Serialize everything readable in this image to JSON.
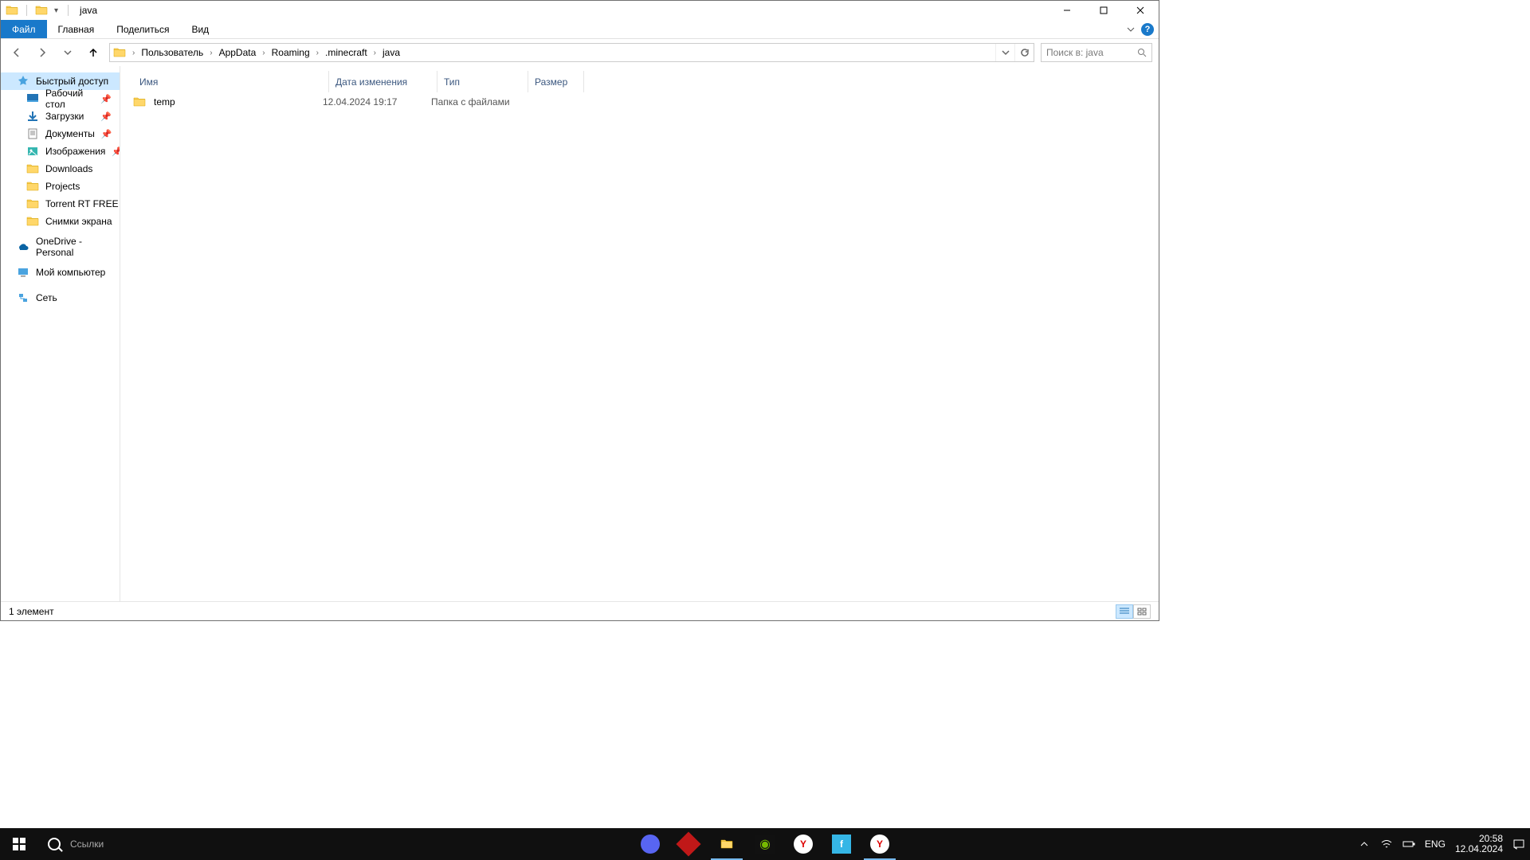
{
  "window": {
    "title": "java"
  },
  "ribbon": {
    "file": "Файл",
    "tabs": [
      "Главная",
      "Поделиться",
      "Вид"
    ],
    "help": "?"
  },
  "breadcrumbs": [
    "Пользователь",
    "AppData",
    "Roaming",
    ".minecraft",
    "java"
  ],
  "search": {
    "placeholder": "Поиск в: java"
  },
  "columns": {
    "name": "Имя",
    "modified": "Дата изменения",
    "type": "Тип",
    "size": "Размер"
  },
  "rows": [
    {
      "name": "temp",
      "modified": "12.04.2024 19:17",
      "type": "Папка с файлами",
      "size": ""
    }
  ],
  "nav": {
    "quick": "Быстрый доступ",
    "quick_items": [
      {
        "label": "Рабочий стол",
        "kind": "desktop",
        "pinned": true
      },
      {
        "label": "Загрузки",
        "kind": "downloads",
        "pinned": true
      },
      {
        "label": "Документы",
        "kind": "documents",
        "pinned": true
      },
      {
        "label": "Изображения",
        "kind": "pictures",
        "pinned": true
      },
      {
        "label": "Downloads",
        "kind": "folder",
        "pinned": false
      },
      {
        "label": "Projects",
        "kind": "folder",
        "pinned": false
      },
      {
        "label": "Torrent RT FREE",
        "kind": "folder",
        "pinned": false
      },
      {
        "label": "Снимки экрана",
        "kind": "folder",
        "pinned": false
      }
    ],
    "onedrive": "OneDrive - Personal",
    "thispc": "Мой компьютер",
    "network": "Сеть"
  },
  "status": {
    "count": "1 элемент"
  },
  "taskbar": {
    "search": "Ссылки",
    "lang": "ENG",
    "time": "20:58",
    "date": "12.04.2024"
  }
}
